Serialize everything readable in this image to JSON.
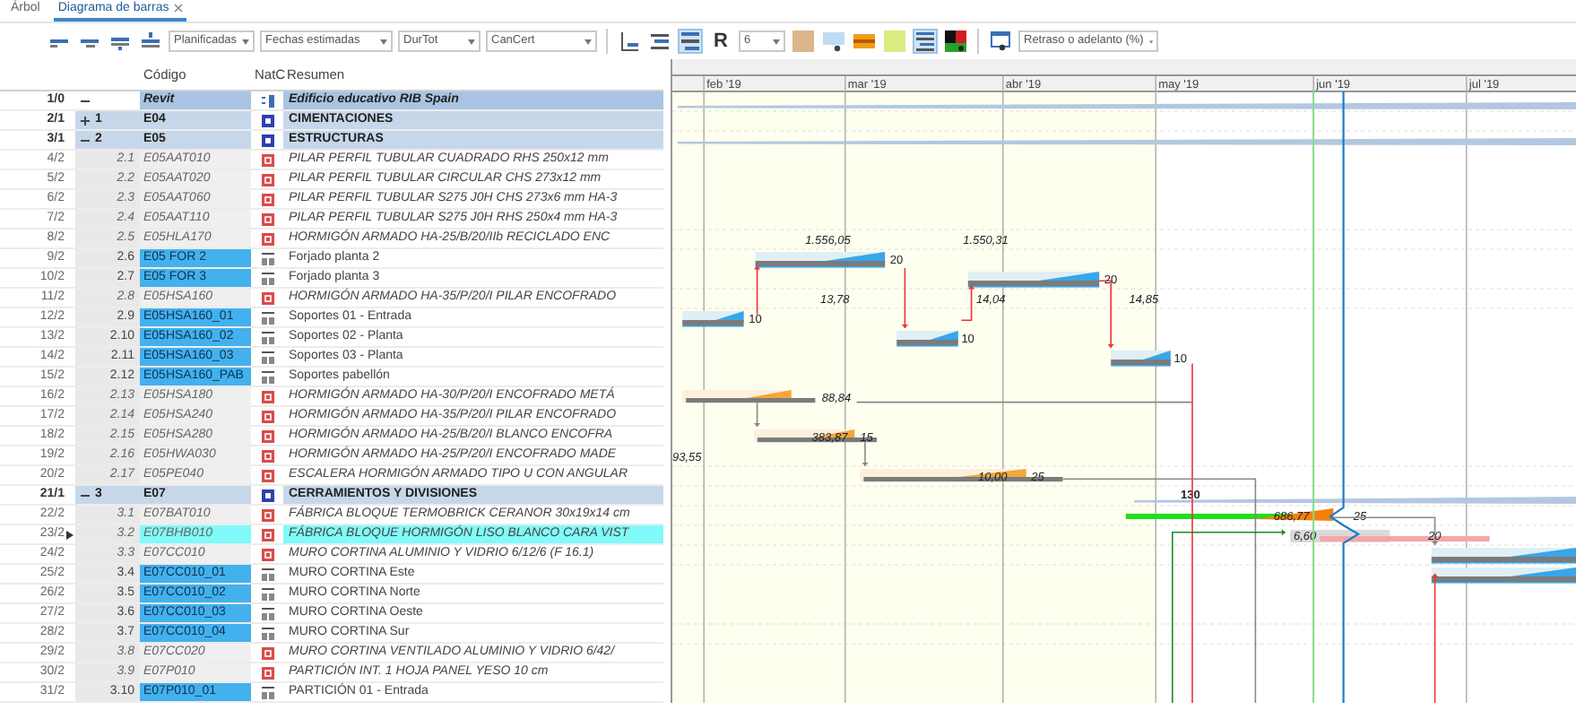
{
  "tabs": [
    {
      "label": "Árbol",
      "selected": false,
      "closable": false
    },
    {
      "label": "Diagrama de barras",
      "selected": true,
      "closable": true
    }
  ],
  "toolbar": [
    {
      "kind": "button",
      "selected": false
    },
    {
      "kind": "button",
      "selected": false
    },
    {
      "kind": "button",
      "selected": false
    },
    {
      "kind": "button",
      "selected": false
    },
    {
      "kind": "dropdown",
      "value": "Planificadas"
    },
    {
      "kind": "dropdown",
      "value": "Fechas estimadas"
    },
    {
      "kind": "dropdown",
      "value": "DurTot"
    },
    {
      "kind": "dropdown",
      "value": "CanCert"
    },
    {
      "kind": "button",
      "selected": false
    },
    {
      "kind": "button",
      "selected": false
    },
    {
      "kind": "button",
      "selected": true
    },
    {
      "kind": "letter",
      "label": "R",
      "selected": false
    },
    {
      "kind": "dropdown",
      "value": "6"
    },
    {
      "kind": "button",
      "selected": false
    },
    {
      "kind": "button",
      "selected": false
    },
    {
      "kind": "button",
      "selected": false
    },
    {
      "kind": "button",
      "selected": false
    },
    {
      "kind": "button",
      "selected": true
    },
    {
      "kind": "button",
      "selected": false
    },
    {
      "kind": "button",
      "selected": false
    },
    {
      "kind": "dropdown",
      "value": "Retraso o adelanto (%)"
    }
  ],
  "table": {
    "columns": [
      "Código",
      "NatC",
      "Resumen"
    ],
    "rows": [
      {
        "number": "1/0",
        "kind": "root",
        "expanded": true,
        "code": "Revit",
        "summary": "Edificio educativo RIB Spain",
        "selected": false
      },
      {
        "number": "2/1",
        "kind": "chapter",
        "expanded": false,
        "outline": "1",
        "code": "E04",
        "summary": "CIMENTACIONES",
        "selected": false
      },
      {
        "number": "3/1",
        "kind": "chapter",
        "expanded": true,
        "outline": "2",
        "code": "E05",
        "summary": "ESTRUCTURAS",
        "selected": false
      },
      {
        "number": "4/2",
        "kind": "item",
        "outline": "2.1",
        "code": "E05AAT010",
        "summary": "PILAR PERFIL TUBULAR CUADRADO RHS 250x12 mm",
        "selected": false
      },
      {
        "number": "5/2",
        "kind": "item",
        "outline": "2.2",
        "code": "E05AAT020",
        "summary": "PILAR PERFIL TUBULAR CIRCULAR CHS 273x12 mm",
        "selected": false
      },
      {
        "number": "6/2",
        "kind": "item",
        "outline": "2.3",
        "code": "E05AAT060",
        "summary": "PILAR PERFIL TUBULAR S275 J0H CHS 273x6 mm HA-3",
        "selected": false
      },
      {
        "number": "7/2",
        "kind": "item",
        "outline": "2.4",
        "code": "E05AAT110",
        "summary": "PILAR PERFIL TUBULAR S275 J0H RHS 250x4 mm HA-3",
        "selected": false
      },
      {
        "number": "8/2",
        "kind": "item",
        "outline": "2.5",
        "code": "E05HLA170",
        "summary": "HORMIGÓN ARMADO HA-25/B/20/IIb RECICLADO ENC",
        "selected": false
      },
      {
        "number": "9/2",
        "kind": "phase",
        "outline": "2.6",
        "code": "E05 FOR 2",
        "summary": "Forjado planta 2",
        "selected": false
      },
      {
        "number": "10/2",
        "kind": "phase",
        "outline": "2.7",
        "code": "E05 FOR 3",
        "summary": "Forjado planta 3",
        "selected": false
      },
      {
        "number": "11/2",
        "kind": "item",
        "outline": "2.8",
        "code": "E05HSA160",
        "summary": "HORMIGÓN ARMADO HA-35/P/20/I PILAR ENCOFRADO",
        "selected": false
      },
      {
        "number": "12/2",
        "kind": "phase",
        "outline": "2.9",
        "code": "E05HSA160_01",
        "summary": "Soportes 01 - Entrada",
        "selected": false
      },
      {
        "number": "13/2",
        "kind": "phase",
        "outline": "2.10",
        "code": "E05HSA160_02",
        "summary": "Soportes 02 - Planta",
        "selected": false
      },
      {
        "number": "14/2",
        "kind": "phase",
        "outline": "2.11",
        "code": "E05HSA160_03",
        "summary": "Soportes 03 - Planta",
        "selected": false
      },
      {
        "number": "15/2",
        "kind": "phase",
        "outline": "2.12",
        "code": "E05HSA160_PAB",
        "summary": "Soportes pabellón",
        "selected": false
      },
      {
        "number": "16/2",
        "kind": "item",
        "outline": "2.13",
        "code": "E05HSA180",
        "summary": "HORMIGÓN ARMADO HA-30/P/20/I ENCOFRADO METÁ",
        "selected": false
      },
      {
        "number": "17/2",
        "kind": "item",
        "outline": "2.14",
        "code": "E05HSA240",
        "summary": "HORMIGÓN ARMADO HA-35/P/20/I PILAR ENCOFRADO",
        "selected": false
      },
      {
        "number": "18/2",
        "kind": "item",
        "outline": "2.15",
        "code": "E05HSA280",
        "summary": "HORMIGÓN ARMADO HA-25/B/20/I BLANCO ENCOFRA",
        "selected": false
      },
      {
        "number": "19/2",
        "kind": "item",
        "outline": "2.16",
        "code": "E05HWA030",
        "summary": "HORMIGÓN ARMADO HA-25/P/20/I ENCOFRADO MADE",
        "selected": false
      },
      {
        "number": "20/2",
        "kind": "item",
        "outline": "2.17",
        "code": "E05PE040",
        "summary": "ESCALERA HORMIGÓN ARMADO TIPO U CON ANGULAR",
        "selected": false
      },
      {
        "number": "21/1",
        "kind": "chapter",
        "expanded": true,
        "outline": "3",
        "code": "E07",
        "summary": "CERRAMIENTOS Y DIVISIONES",
        "selected": false
      },
      {
        "number": "22/2",
        "kind": "item",
        "outline": "3.1",
        "code": "E07BAT010",
        "summary": "FÁBRICA BLOQUE TERMOBRICK CERANOR 30x19x14 cm",
        "selected": false
      },
      {
        "number": "23/2",
        "kind": "item",
        "outline": "3.2",
        "code": "E07BHB010",
        "summary": "FÁBRICA BLOQUE HORMIGÓN LISO BLANCO CARA VIST",
        "selected": true,
        "current": true
      },
      {
        "number": "24/2",
        "kind": "item",
        "outline": "3.3",
        "code": "E07CC010",
        "summary": "MURO CORTINA ALUMINIO Y VIDRIO 6/12/6 (F 16.1)",
        "selected": false
      },
      {
        "number": "25/2",
        "kind": "phase",
        "outline": "3.4",
        "code": "E07CC010_01",
        "summary": "MURO CORTINA Este",
        "selected": false
      },
      {
        "number": "26/2",
        "kind": "phase",
        "outline": "3.5",
        "code": "E07CC010_02",
        "summary": "MURO CORTINA Norte",
        "selected": false
      },
      {
        "number": "27/2",
        "kind": "phase",
        "outline": "3.6",
        "code": "E07CC010_03",
        "summary": "MURO CORTINA Oeste",
        "selected": false
      },
      {
        "number": "28/2",
        "kind": "phase",
        "outline": "3.7",
        "code": "E07CC010_04",
        "summary": "MURO CORTINA Sur",
        "selected": false
      },
      {
        "number": "29/2",
        "kind": "item",
        "outline": "3.8",
        "code": "E07CC020",
        "summary": "MURO CORTINA VENTILADO ALUMINIO Y VIDRIO 6/42/",
        "selected": false
      },
      {
        "number": "30/2",
        "kind": "item",
        "outline": "3.9",
        "code": "E07P010",
        "summary": "PARTICIÓN INT. 1 HOJA PANEL YESO 10 cm",
        "selected": false
      },
      {
        "number": "31/2",
        "kind": "phase",
        "outline": "3.10",
        "code": "E07P010_01",
        "summary": "PARTICIÓN 01 - Entrada",
        "selected": false
      }
    ]
  },
  "gantt": {
    "months": [
      "feb '19",
      "mar '19",
      "abr '19",
      "may '19",
      "jun '19",
      "jul '19"
    ],
    "bars": [
      {
        "kind": "summary"
      },
      {
        "kind": "summary"
      },
      {
        "kind": "task",
        "labels": [
          "1.556,05",
          "20"
        ]
      },
      {
        "kind": "task",
        "labels": [
          "1.550,31",
          "20"
        ]
      },
      {
        "kind": "task",
        "labels": [
          "10"
        ]
      },
      {
        "kind": "task",
        "labels": [
          "10",
          "13,78"
        ]
      },
      {
        "kind": "task",
        "labels": [
          "10",
          "14,04",
          "14,85"
        ]
      },
      {
        "kind": "weighted",
        "labels": [
          "88,84"
        ]
      },
      {
        "kind": "weighted",
        "labels": [
          "383,87",
          "15"
        ]
      },
      {
        "kind": "weighted",
        "labels": [
          "10,00",
          "25",
          "93,55"
        ]
      },
      {
        "kind": "summary",
        "labels": [
          "130"
        ]
      },
      {
        "kind": "critical",
        "labels": [
          "686,77",
          "25"
        ]
      },
      {
        "kind": "delayed",
        "labels": [
          "6,60",
          "20"
        ]
      },
      {
        "kind": "task"
      },
      {
        "kind": "task"
      }
    ]
  }
}
